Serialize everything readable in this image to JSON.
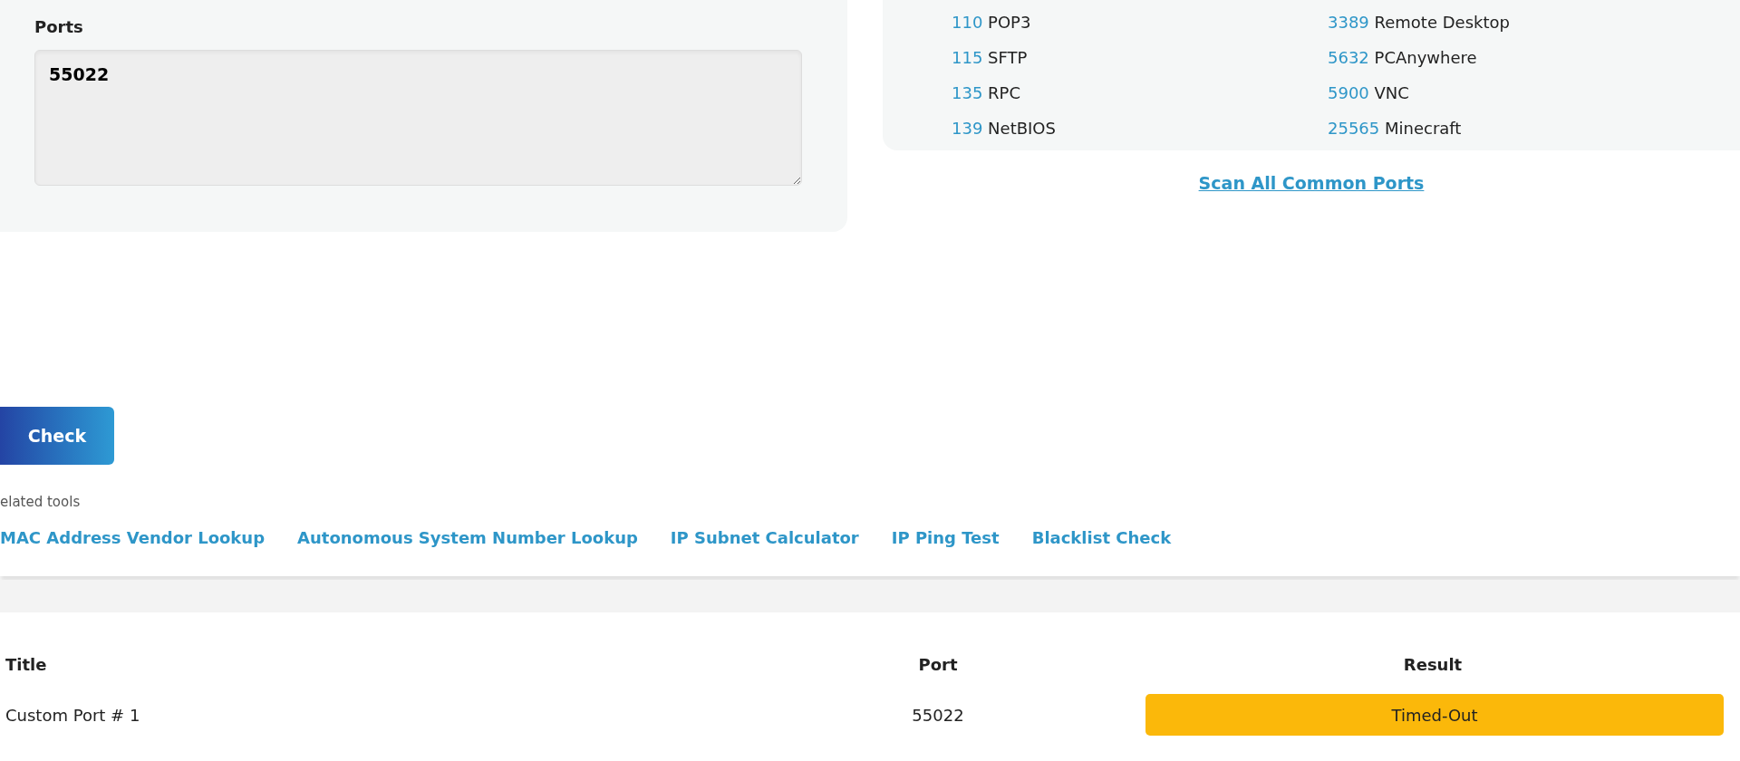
{
  "ports_field": {
    "label": "Ports",
    "value": "55022"
  },
  "common_ports": [
    {
      "number": "110",
      "name": "POP3"
    },
    {
      "number": "3389",
      "name": "Remote Desktop"
    },
    {
      "number": "115",
      "name": "SFTP"
    },
    {
      "number": "5632",
      "name": "PCAnywhere"
    },
    {
      "number": "135",
      "name": "RPC"
    },
    {
      "number": "5900",
      "name": "VNC"
    },
    {
      "number": "139",
      "name": "NetBIOS"
    },
    {
      "number": "25565",
      "name": "Minecraft"
    }
  ],
  "scan_all_link": "Scan All Common Ports",
  "check_button": "Check",
  "related_tools": {
    "label": "elated tools",
    "links": [
      "MAC Address Vendor Lookup",
      "Autonomous System Number Lookup",
      "IP Subnet Calculator",
      "IP Ping Test",
      "Blacklist Check"
    ]
  },
  "results_table": {
    "columns": [
      "Title",
      "Port",
      "Result"
    ],
    "rows": [
      {
        "title": "Custom Port # 1",
        "port": "55022",
        "result": "Timed-Out",
        "color": "#fbb80a"
      }
    ]
  }
}
